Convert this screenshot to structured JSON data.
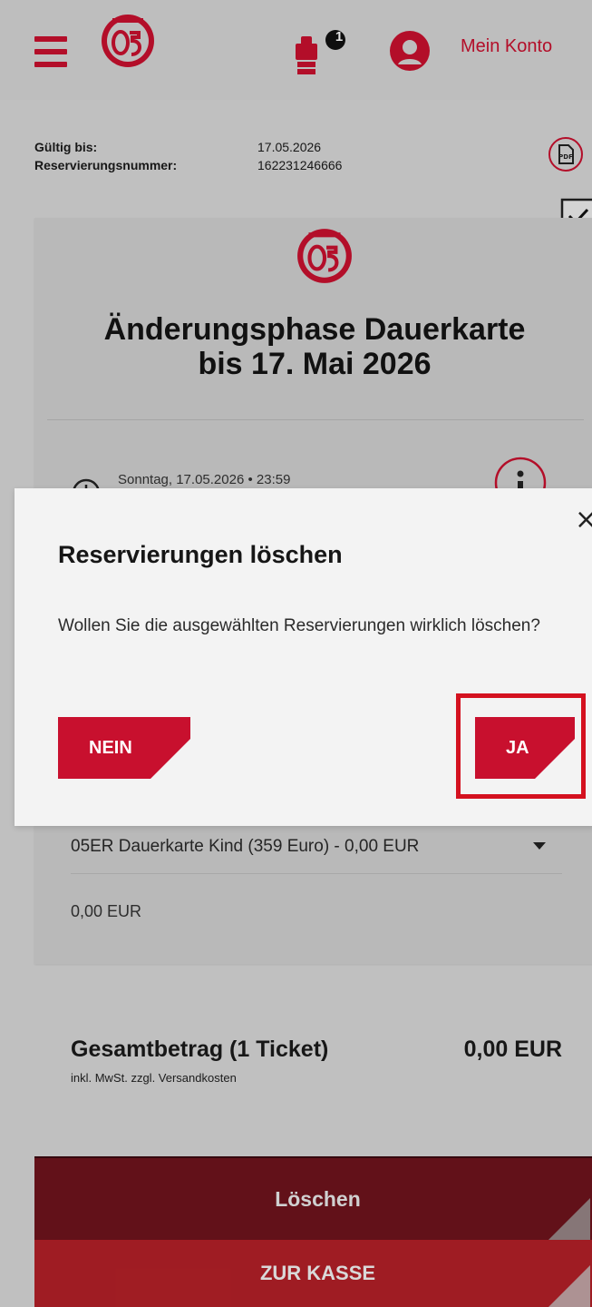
{
  "header": {
    "account_label": "Mein Konto",
    "cart_count": "1"
  },
  "reservation": {
    "valid_until_label": "Gültig bis:",
    "valid_until_value": "17.05.2026",
    "number_label": "Reservierungsnummer:",
    "number_value": "162231246666"
  },
  "card": {
    "title_line1": "Änderungsphase Dauerkarte",
    "title_line2": "bis 17. Mai 2026",
    "date": "Sonntag, 17.05.2026 • 23:59",
    "ticket_type": "05ER Dauerkarte Kind (359 Euro) - 0,00 EUR",
    "ticket_price": "0,00 EUR"
  },
  "summary": {
    "total_label": "Gesamtbetrag (1 Ticket)",
    "total_note": "inkl. MwSt. zzgl. Versandkosten",
    "total_value": "0,00 EUR"
  },
  "actions": {
    "delete_label": "Löschen",
    "checkout_label": "ZUR KASSE"
  },
  "modal": {
    "title": "Reservierungen löschen",
    "body": "Wollen Sie die ausgewählten Reservierungen wirklich löschen?",
    "no_label": "NEIN",
    "yes_label": "JA",
    "close_symbol": "×"
  },
  "colors": {
    "brand_red": "#c8102e",
    "dark_red": "#6e141c",
    "highlight": "#d4111f"
  },
  "icons": [
    "menu-icon",
    "club-logo",
    "cart-icon",
    "account-icon",
    "pdf-icon",
    "checkbox-icon",
    "clock-icon",
    "info-icon",
    "close-icon",
    "chevron-down-icon"
  ]
}
